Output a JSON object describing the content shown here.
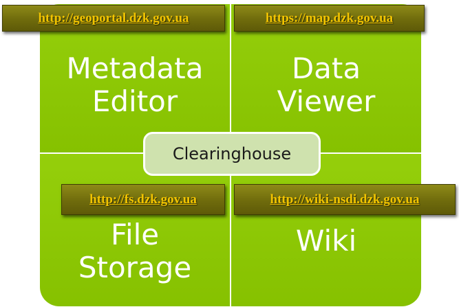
{
  "quadrants": {
    "top_left": "Metadata\nEditor",
    "top_right": "Data\nViewer",
    "bottom_left": "File\nStorage",
    "bottom_right": "Wiki"
  },
  "center": {
    "label": "Clearinghouse"
  },
  "links": {
    "top_left": "http://geoportal.dzk.gov.ua",
    "top_right": "https://map.dzk.gov.ua",
    "bottom_left": "http://fs.dzk.gov.ua",
    "bottom_right": "http://wiki-nsdi.dzk.gov.ua"
  },
  "colors": {
    "quadrant_fill": "#8cc800",
    "center_fill": "#cfe2ae",
    "badge_fill": "#6f6b0c",
    "link_text": "#f2c400"
  }
}
